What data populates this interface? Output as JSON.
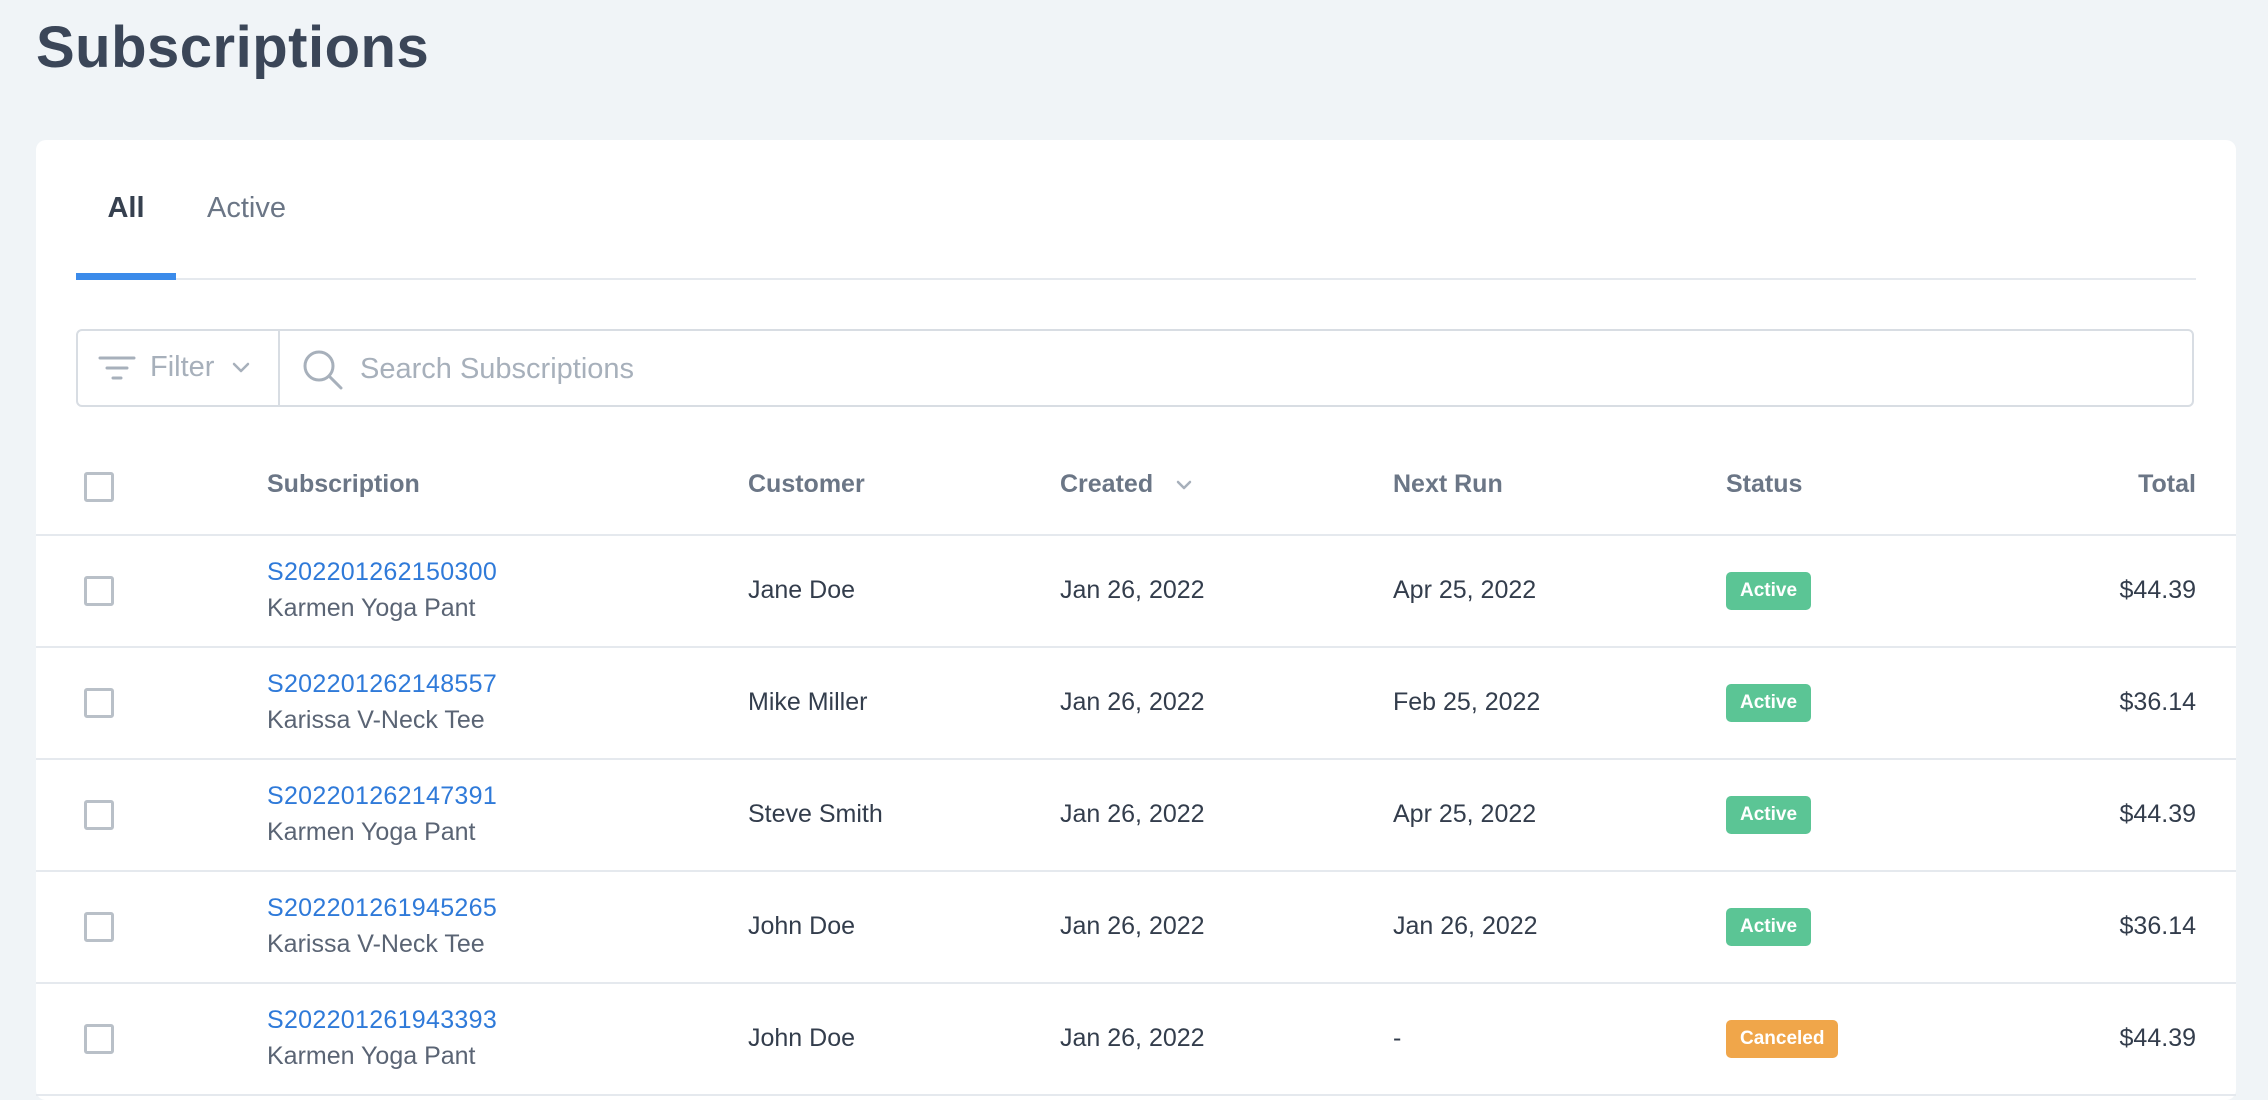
{
  "page": {
    "title": "Subscriptions"
  },
  "tabs": [
    {
      "label": "All",
      "selected": true
    },
    {
      "label": "Active",
      "selected": false
    }
  ],
  "toolbar": {
    "filter_label": "Filter",
    "search_placeholder": "Search Subscriptions"
  },
  "colors": {
    "accent": "#3b8bea",
    "link": "#2f7ad9",
    "active": "#5bc595",
    "canceled": "#f0a64a"
  },
  "table": {
    "columns": {
      "subscription": "Subscription",
      "customer": "Customer",
      "created": "Created",
      "next_run": "Next Run",
      "status": "Status",
      "total": "Total"
    },
    "rows": [
      {
        "id": "S202201262150300",
        "product": "Karmen Yoga Pant",
        "customer": "Jane Doe",
        "created": "Jan 26, 2022",
        "next_run": "Apr 25, 2022",
        "status": "Active",
        "total": "$44.39"
      },
      {
        "id": "S202201262148557",
        "product": "Karissa V-Neck Tee",
        "customer": "Mike Miller",
        "created": "Jan 26, 2022",
        "next_run": "Feb 25, 2022",
        "status": "Active",
        "total": "$36.14"
      },
      {
        "id": "S202201262147391",
        "product": "Karmen Yoga Pant",
        "customer": "Steve Smith",
        "created": "Jan 26, 2022",
        "next_run": "Apr 25, 2022",
        "status": "Active",
        "total": "$44.39"
      },
      {
        "id": "S202201261945265",
        "product": "Karissa V-Neck Tee",
        "customer": "John Doe",
        "created": "Jan 26, 2022",
        "next_run": "Jan 26, 2022",
        "status": "Active",
        "total": "$36.14"
      },
      {
        "id": "S202201261943393",
        "product": "Karmen Yoga Pant",
        "customer": "John Doe",
        "created": "Jan 26, 2022",
        "next_run": "-",
        "status": "Canceled",
        "total": "$44.39"
      }
    ]
  }
}
